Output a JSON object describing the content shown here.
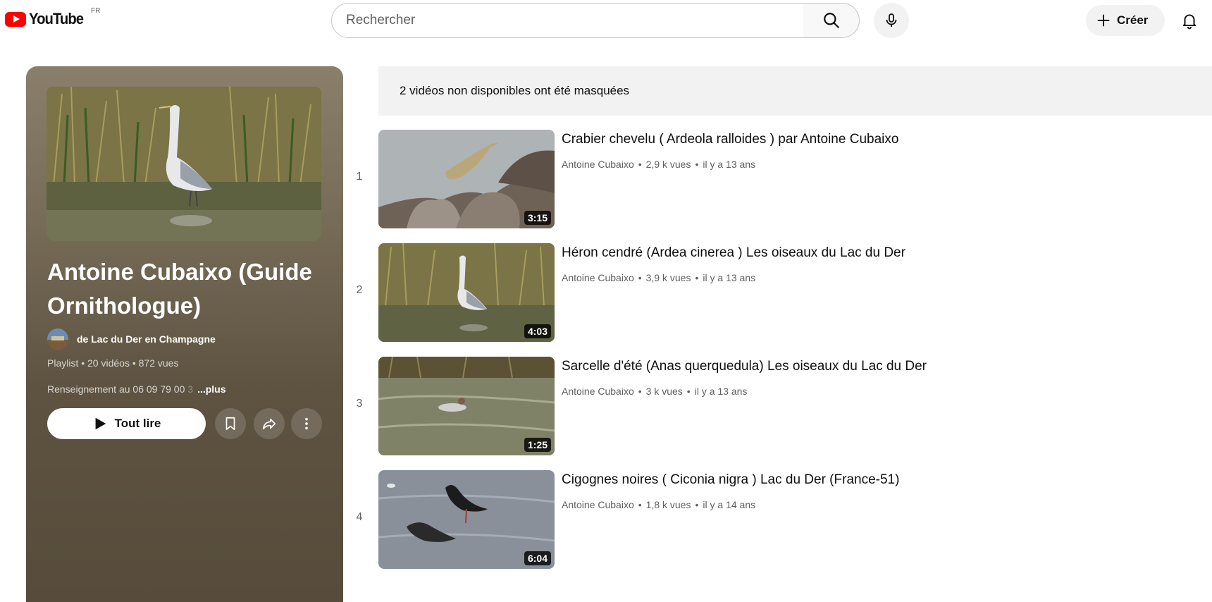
{
  "header": {
    "logo_text": "YouTube",
    "region": "FR",
    "search_placeholder": "Rechercher",
    "create_label": "Créer",
    "icons": [
      "search-icon",
      "mic-icon",
      "plus-icon",
      "bell-icon"
    ]
  },
  "playlist": {
    "title": "Antoine Cubaixo (Guide Ornithologue)",
    "owner": "de Lac du Der en Champagne",
    "meta": "Playlist • 20 vidéos • 872 vues",
    "description_visible": "Renseignement au 06 09 79 00 ",
    "description_faded": "3",
    "more_label": "...plus",
    "play_all_label": "Tout lire",
    "icons": [
      "play-icon",
      "save-icon",
      "share-icon",
      "more-icon"
    ]
  },
  "notice": "2 vidéos non disponibles ont été masquées",
  "videos": [
    {
      "index": "1",
      "title": "Crabier chevelu ( Ardeola ralloides ) par Antoine Cubaixo",
      "channel": "Antoine Cubaixo",
      "views": "2,9 k vues",
      "age": "il y a 13 ans",
      "duration": "3:15"
    },
    {
      "index": "2",
      "title": "Héron cendré (Ardea cinerea ) Les oiseaux du Lac du Der",
      "channel": "Antoine Cubaixo",
      "views": "3,9 k vues",
      "age": "il y a 13 ans",
      "duration": "4:03"
    },
    {
      "index": "3",
      "title": "Sarcelle d'été (Anas querquedula) Les oiseaux du Lac du Der",
      "channel": "Antoine Cubaixo",
      "views": "3 k vues",
      "age": "il y a 13 ans",
      "duration": "1:25"
    },
    {
      "index": "4",
      "title": "Cigognes noires ( Ciconia nigra ) Lac du Der (France-51)",
      "channel": "Antoine Cubaixo",
      "views": "1,8 k vues",
      "age": "il y a 14 ans",
      "duration": "6:04"
    }
  ],
  "colors": {
    "brand_red": "#ff0000",
    "panel": "#5e5341",
    "notice_bg": "#f2f2f2",
    "meta_text": "#606060"
  }
}
